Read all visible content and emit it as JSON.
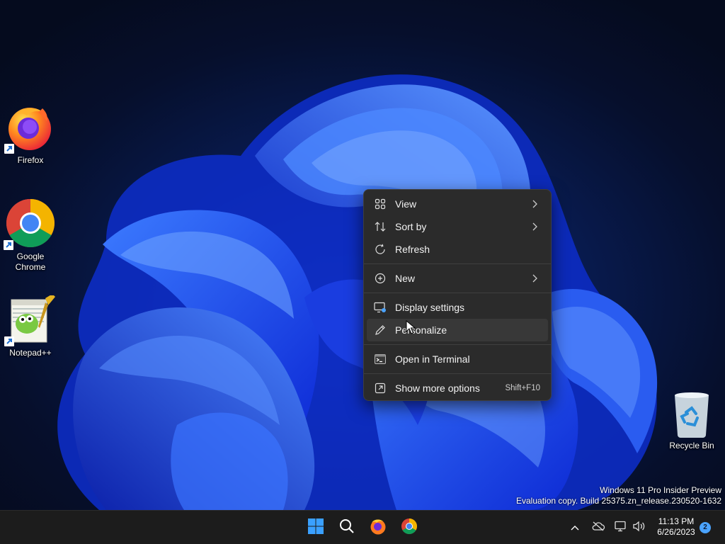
{
  "desktop": {
    "icons": [
      {
        "label": "Firefox",
        "icon": "firefox-icon"
      },
      {
        "label": "Google Chrome",
        "icon": "chrome-icon"
      },
      {
        "label": "Notepad++",
        "icon": "notepadpp-icon"
      },
      {
        "label": "Recycle Bin",
        "icon": "recycle-bin-icon"
      }
    ],
    "watermark": {
      "line1": "Windows 11 Pro Insider Preview",
      "line2": "Evaluation copy. Build 25375.zn_release.230520-1632"
    }
  },
  "context_menu": {
    "items": [
      {
        "label": "View",
        "icon": "grid-icon",
        "submenu": true
      },
      {
        "label": "Sort by",
        "icon": "sort-icon",
        "submenu": true
      },
      {
        "label": "Refresh",
        "icon": "refresh-icon"
      },
      {
        "label": "New",
        "icon": "add-circle-icon",
        "submenu": true
      },
      {
        "label": "Display settings",
        "icon": "display-icon"
      },
      {
        "label": "Personalize",
        "icon": "pen-icon",
        "hovered": true
      },
      {
        "label": "Open in Terminal",
        "icon": "terminal-icon"
      },
      {
        "label": "Show more options",
        "icon": "more-options-icon",
        "shortcut": "Shift+F10"
      }
    ]
  },
  "taskbar": {
    "pinned": [
      {
        "icon": "windows-start-icon"
      },
      {
        "icon": "search-icon"
      },
      {
        "icon": "firefox-icon"
      },
      {
        "icon": "chrome-icon"
      }
    ],
    "tray": {
      "icons": [
        "chevron-up-icon",
        "cloud-offline-icon",
        "network-icon",
        "volume-icon"
      ],
      "time": "11:13 PM",
      "date": "6/26/2023",
      "notification_count": "2"
    }
  },
  "colors": {
    "menu_bg": "#2b2b2b",
    "taskbar_bg": "#1c1c1c",
    "wallpaper_accent": "#1f4fff"
  }
}
